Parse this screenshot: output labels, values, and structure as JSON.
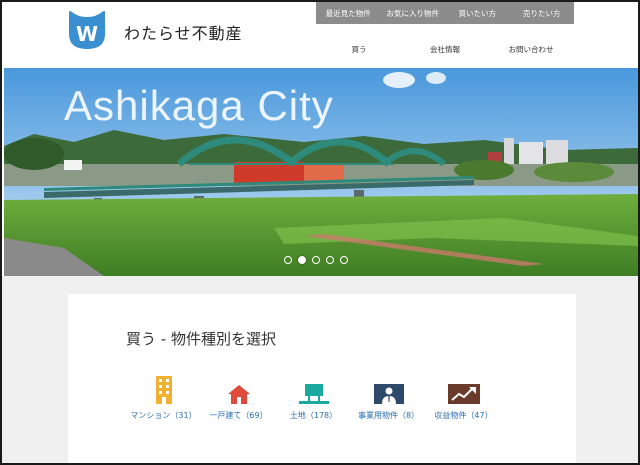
{
  "site": {
    "name": "わたらせ不動産",
    "logo_letter": "W"
  },
  "topbar": [
    "最近見た物件",
    "お気に入り物件",
    "買いたい方",
    "売りたい方"
  ],
  "mainnav": [
    "買う",
    "会社情報",
    "お問い合わせ"
  ],
  "hero": {
    "title": "Ashikaga City",
    "slide_count": 5,
    "active_slide": 2
  },
  "section": {
    "title": "買う - 物件種別を選択"
  },
  "property_types": [
    {
      "label": "マンション（31）",
      "icon": "building-icon",
      "color": "#f0b030"
    },
    {
      "label": "一戸建て（69）",
      "icon": "house-icon",
      "color": "#e04a3a"
    },
    {
      "label": "土地（178）",
      "icon": "land-sign-icon",
      "color": "#1aa8a0"
    },
    {
      "label": "事業用物件（8）",
      "icon": "business-person-icon",
      "color": "#2e4a6a"
    },
    {
      "label": "収益物件（47）",
      "icon": "chart-up-icon",
      "color": "#6a3a2a"
    }
  ],
  "colors": {
    "accent": "#2a6fb0",
    "topbar": "#8c8c8c",
    "logo": "#3a8fd0"
  }
}
